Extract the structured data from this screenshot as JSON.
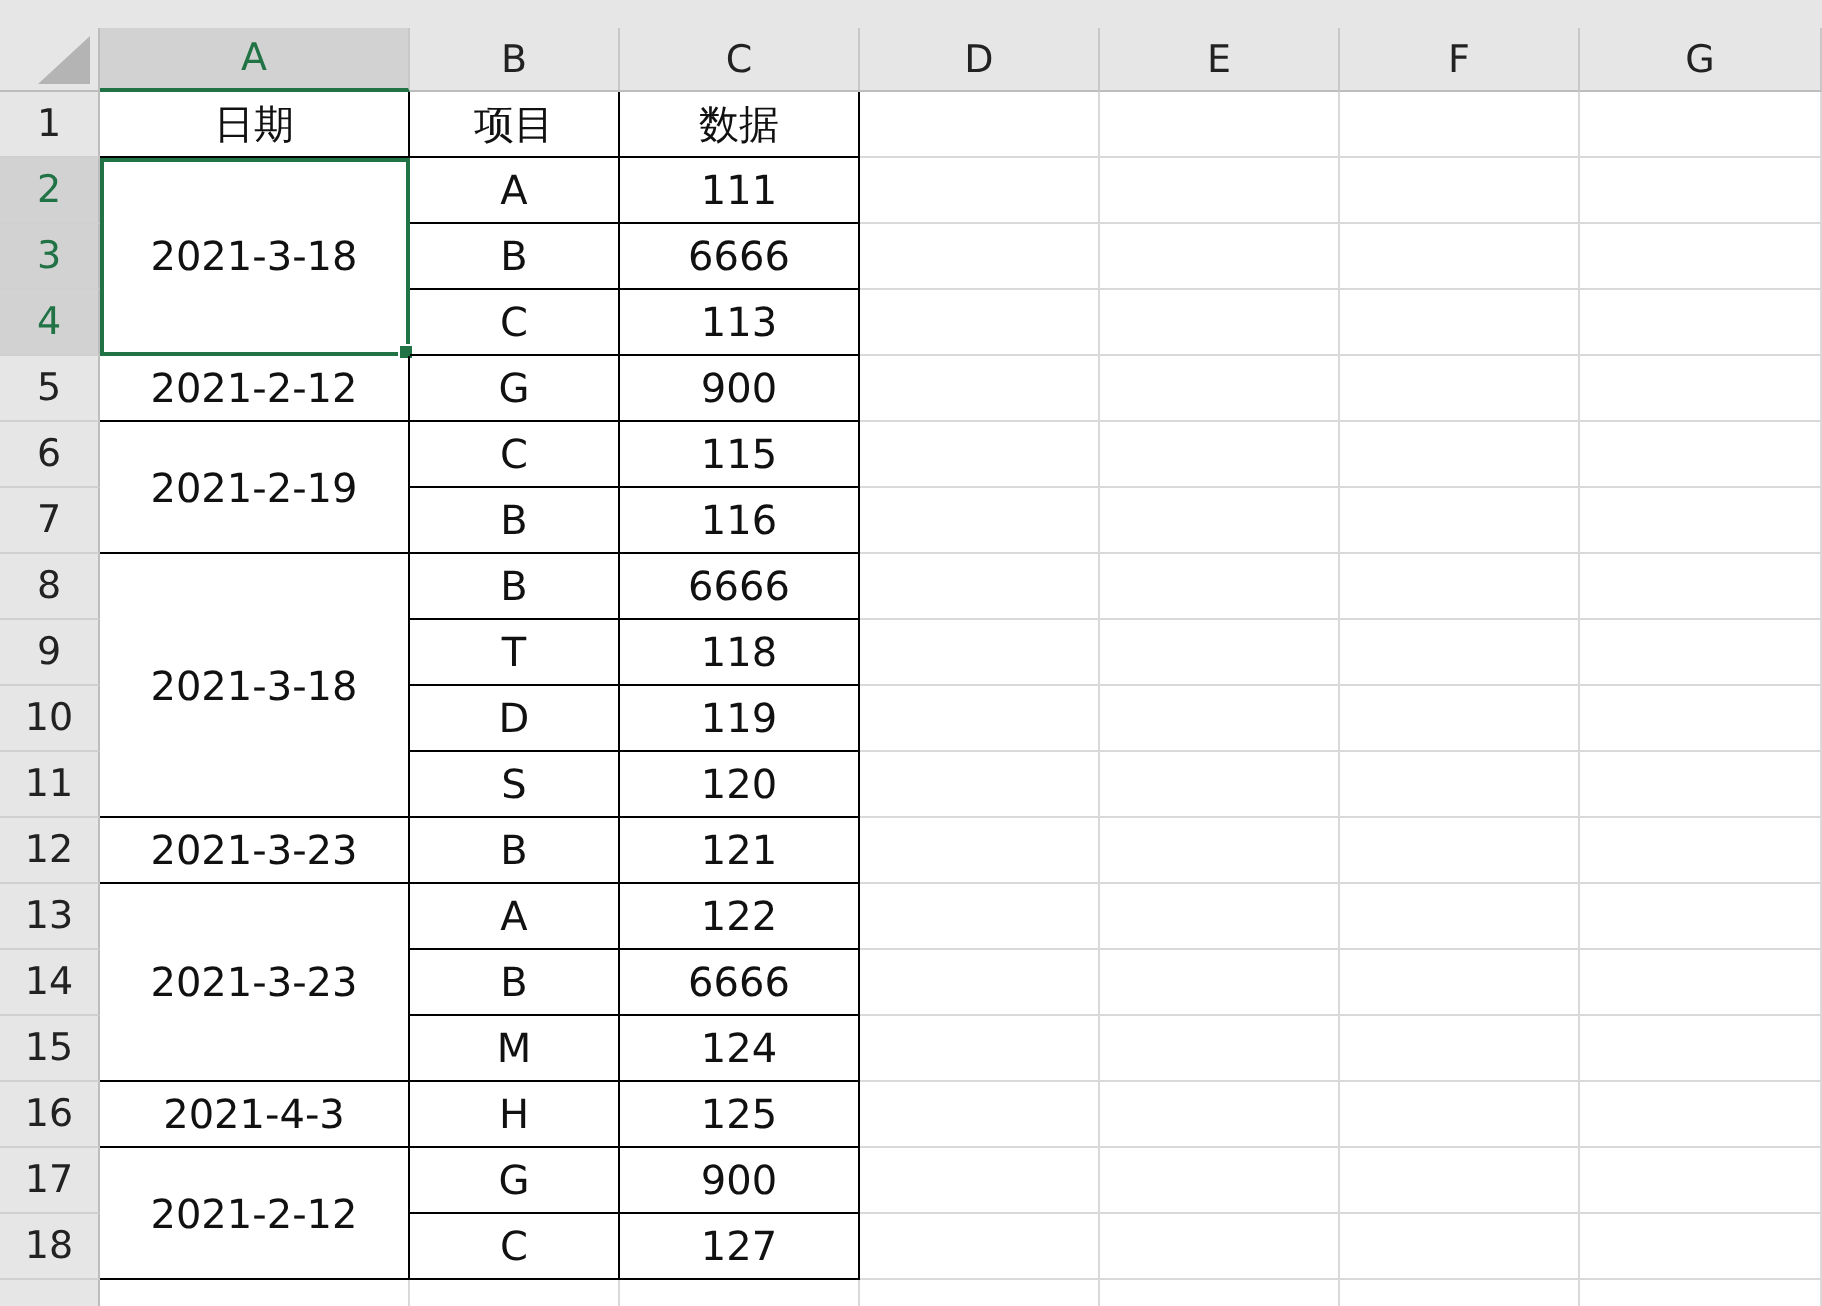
{
  "columns": [
    {
      "label": "A",
      "selected": true
    },
    {
      "label": "B",
      "selected": false
    },
    {
      "label": "C",
      "selected": false
    },
    {
      "label": "D",
      "selected": false
    },
    {
      "label": "E",
      "selected": false
    },
    {
      "label": "F",
      "selected": false
    },
    {
      "label": "G",
      "selected": false
    }
  ],
  "row_numbers": [
    {
      "label": "1",
      "selected": false
    },
    {
      "label": "2",
      "selected": true
    },
    {
      "label": "3",
      "selected": true
    },
    {
      "label": "4",
      "selected": true
    },
    {
      "label": "5",
      "selected": false
    },
    {
      "label": "6",
      "selected": false
    },
    {
      "label": "7",
      "selected": false
    },
    {
      "label": "8",
      "selected": false
    },
    {
      "label": "9",
      "selected": false
    },
    {
      "label": "10",
      "selected": false
    },
    {
      "label": "11",
      "selected": false
    },
    {
      "label": "12",
      "selected": false
    },
    {
      "label": "13",
      "selected": false
    },
    {
      "label": "14",
      "selected": false
    },
    {
      "label": "15",
      "selected": false
    },
    {
      "label": "16",
      "selected": false
    },
    {
      "label": "17",
      "selected": false
    },
    {
      "label": "18",
      "selected": false
    }
  ],
  "header": [
    "日期",
    "项目",
    "数据"
  ],
  "groups": [
    {
      "date": "2021-3-18",
      "selected": true,
      "items": [
        {
          "item": "A",
          "value": "111"
        },
        {
          "item": "B",
          "value": "6666"
        },
        {
          "item": "C",
          "value": "113"
        }
      ]
    },
    {
      "date": "2021-2-12",
      "selected": false,
      "items": [
        {
          "item": "G",
          "value": "900"
        }
      ]
    },
    {
      "date": "2021-2-19",
      "selected": false,
      "items": [
        {
          "item": "C",
          "value": "115"
        },
        {
          "item": "B",
          "value": "116"
        }
      ]
    },
    {
      "date": "2021-3-18",
      "selected": false,
      "items": [
        {
          "item": "B",
          "value": "6666"
        },
        {
          "item": "T",
          "value": "118"
        },
        {
          "item": "D",
          "value": "119"
        },
        {
          "item": "S",
          "value": "120"
        }
      ]
    },
    {
      "date": "2021-3-23",
      "selected": false,
      "items": [
        {
          "item": "B",
          "value": "121"
        }
      ]
    },
    {
      "date": "2021-3-23",
      "selected": false,
      "items": [
        {
          "item": "A",
          "value": "122"
        },
        {
          "item": "B",
          "value": "6666"
        },
        {
          "item": "M",
          "value": "124"
        }
      ]
    },
    {
      "date": "2021-4-3",
      "selected": false,
      "items": [
        {
          "item": "H",
          "value": "125"
        }
      ]
    },
    {
      "date": "2021-2-12",
      "selected": false,
      "items": [
        {
          "item": "G",
          "value": "900"
        },
        {
          "item": "C",
          "value": "127"
        }
      ]
    }
  ]
}
